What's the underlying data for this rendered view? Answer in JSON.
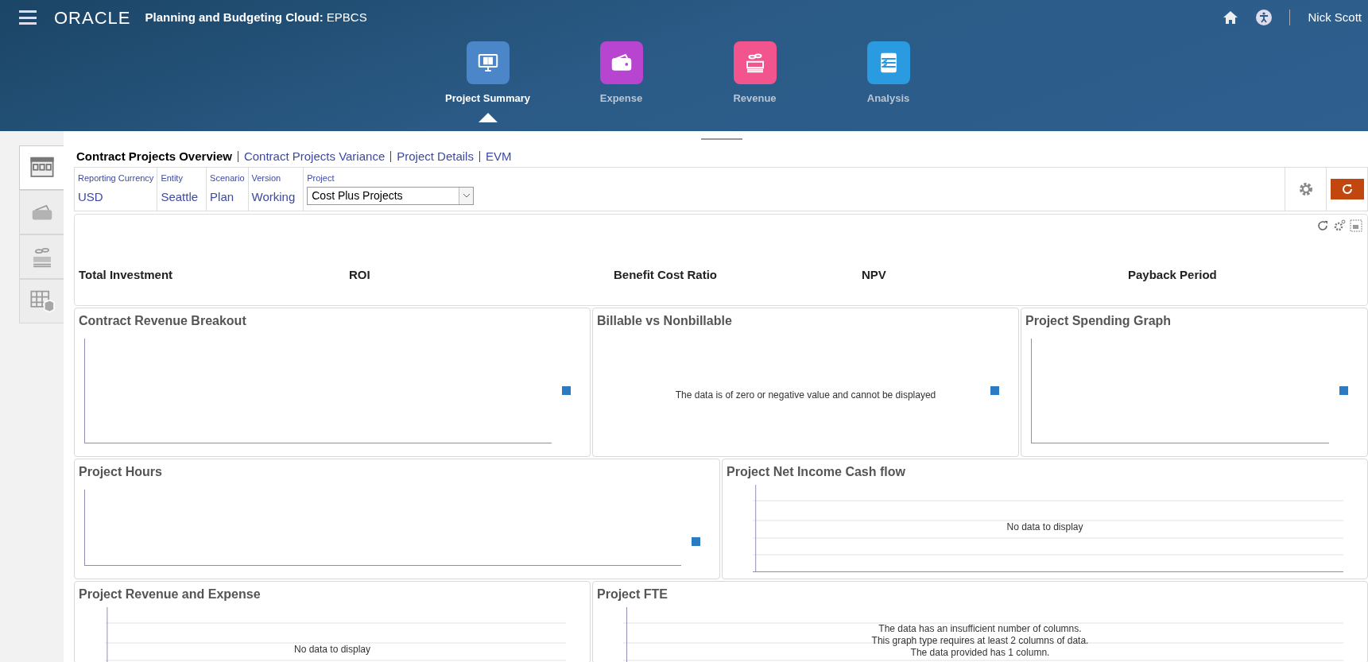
{
  "header": {
    "brand": "ORACLE",
    "app_title": "Planning and Budgeting Cloud:",
    "app_subtitle": "EPBCS",
    "user": "Nick Scott"
  },
  "cards": [
    {
      "label": "Project Summary",
      "kind": "monitor",
      "color": "#4a86c8",
      "selected": true
    },
    {
      "label": "Expense",
      "kind": "wallet",
      "color": "#b845cf",
      "selected": false
    },
    {
      "label": "Revenue",
      "kind": "cash",
      "color": "#f2558e",
      "selected": false
    },
    {
      "label": "Analysis",
      "kind": "checklist",
      "color": "#2a9be0",
      "selected": false
    }
  ],
  "side_tabs": [
    {
      "kind": "dashboard",
      "selected": true
    },
    {
      "kind": "wallet",
      "selected": false
    },
    {
      "kind": "cash",
      "selected": false
    },
    {
      "kind": "cube",
      "selected": false
    }
  ],
  "links": [
    {
      "label": "Contract Projects Overview",
      "selected": true
    },
    {
      "label": "Contract Projects Variance",
      "selected": false
    },
    {
      "label": "Project Details",
      "selected": false
    },
    {
      "label": "EVM",
      "selected": false
    }
  ],
  "filters": [
    {
      "kind": "text",
      "label": "Reporting Currency",
      "value": "USD"
    },
    {
      "kind": "text",
      "label": "Entity",
      "value": "Seattle"
    },
    {
      "kind": "text",
      "label": "Scenario",
      "value": "Plan"
    },
    {
      "kind": "text",
      "label": "Version",
      "value": "Working"
    },
    {
      "kind": "select",
      "label": "Project",
      "value": "Cost Plus Projects"
    }
  ],
  "kpis": [
    "Total Investment",
    "ROI",
    "Benefit Cost Ratio",
    "NPV",
    "Payback Period"
  ],
  "chart_rows": [
    [
      {
        "title": "Contract Revenue Breakout",
        "kind": "axes",
        "legend": true
      },
      {
        "title": "Billable vs Nonbillable",
        "kind": "message",
        "message": "The data is of zero or negative value and cannot be displayed",
        "legend": true
      },
      {
        "title": "Project Spending Graph",
        "kind": "axes",
        "legend": true
      }
    ],
    [
      {
        "title": "Project Hours",
        "kind": "axes",
        "legend": true
      },
      {
        "title": "Project Net Income Cash flow",
        "kind": "grid",
        "message": "No data to display",
        "legend": false
      }
    ],
    [
      {
        "title": "Project Revenue and Expense",
        "kind": "grid",
        "message": "No data to display",
        "legend": false
      },
      {
        "title": "Project FTE",
        "kind": "grid",
        "lines": [
          "The data has an insufficient number of columns.",
          "This graph type requires at least 2 columns of data.",
          "The data provided has 1 column."
        ],
        "legend": false
      }
    ]
  ]
}
